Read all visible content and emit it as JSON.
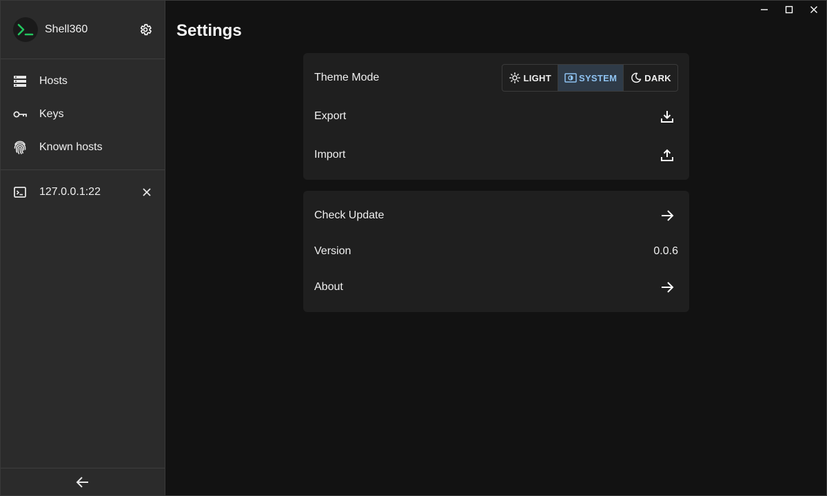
{
  "app": {
    "name": "Shell360"
  },
  "sidebar": {
    "items": [
      {
        "label": "Hosts",
        "icon": "hosts-icon"
      },
      {
        "label": "Keys",
        "icon": "key-icon"
      },
      {
        "label": "Known hosts",
        "icon": "fingerprint-icon"
      }
    ],
    "sessions": [
      {
        "label": "127.0.0.1:22",
        "icon": "terminal-icon"
      }
    ]
  },
  "page": {
    "title": "Settings"
  },
  "settings": {
    "theme_label": "Theme Mode",
    "theme_options": [
      {
        "label": "LIGHT",
        "icon": "sun-icon"
      },
      {
        "label": "SYSTEM",
        "icon": "system-theme-icon"
      },
      {
        "label": "DARK",
        "icon": "moon-icon"
      }
    ],
    "theme_selected": "SYSTEM",
    "export_label": "Export",
    "import_label": "Import",
    "check_update_label": "Check Update",
    "version_label": "Version",
    "version_value": "0.0.6",
    "about_label": "About"
  },
  "colors": {
    "sidebar_bg": "#2b2b2b",
    "main_bg": "#121212",
    "card_bg": "#1f1f1f",
    "accent": "#8fc3f2",
    "logo_green": "#22c55e"
  }
}
